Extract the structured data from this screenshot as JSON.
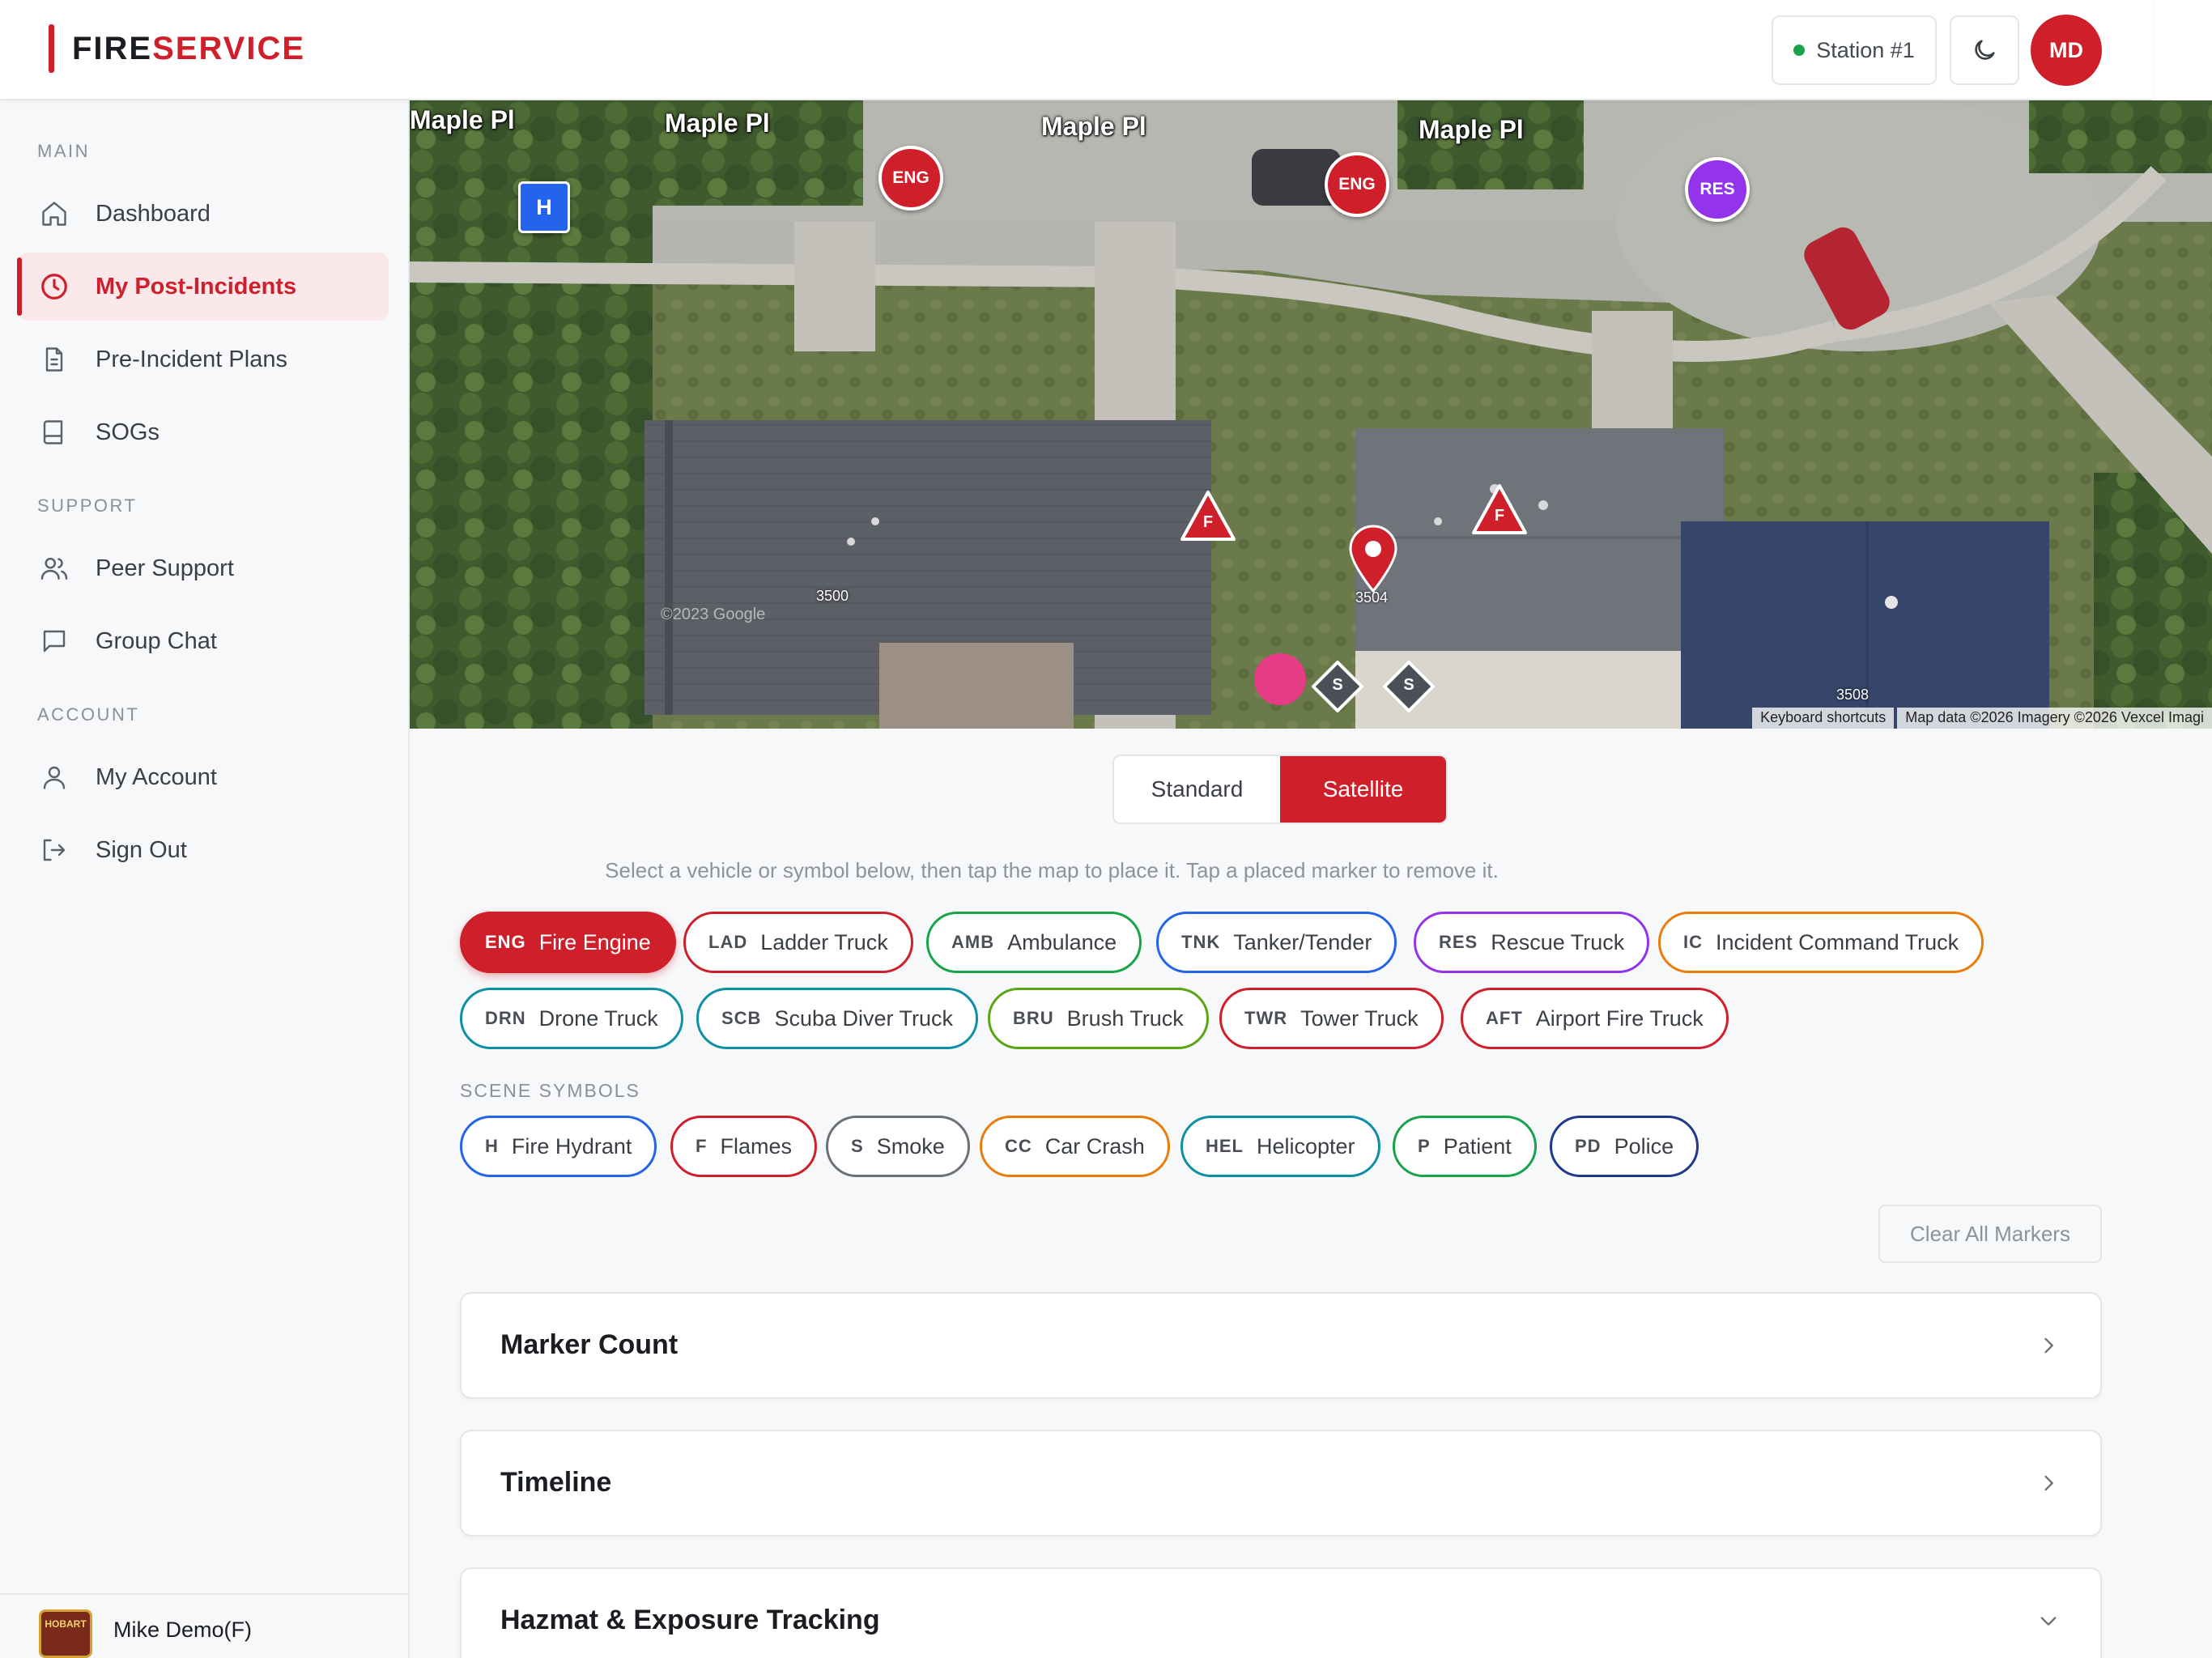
{
  "header": {
    "logo_fire": "FIRE",
    "logo_service": "SERVICE",
    "station": "Station #1",
    "theme_icon": "moon-icon",
    "avatar_initials": "MD"
  },
  "sidebar": {
    "section_main": "MAIN",
    "section_support": "SUPPORT",
    "section_account": "ACCOUNT",
    "items": [
      {
        "label": "Dashboard",
        "icon": "home-icon"
      },
      {
        "label": "My Post-Incidents",
        "icon": "clock-icon"
      },
      {
        "label": "Pre-Incident Plans",
        "icon": "document-icon"
      },
      {
        "label": "SOGs",
        "icon": "book-icon"
      },
      {
        "label": "Peer Support",
        "icon": "users-icon"
      },
      {
        "label": "Group Chat",
        "icon": "chat-icon"
      },
      {
        "label": "My Account",
        "icon": "user-icon"
      },
      {
        "label": "Sign Out",
        "icon": "sign-out-icon"
      }
    ],
    "user_name": "Mike Demo(F)",
    "user_badge": "HOBART"
  },
  "map": {
    "streets": [
      "Maple Pl",
      "Maple Pl",
      "Maple Pl",
      "Maple Pl"
    ],
    "house_numbers": [
      "3500",
      "3504",
      "3508"
    ],
    "markers": {
      "hydrant": "H",
      "eng1": "ENG",
      "eng2": "ENG",
      "res": "RES",
      "flame1": "F",
      "flame2": "F",
      "smoke1": "S",
      "smoke2": "S"
    },
    "attribution_shortcuts": "Keyboard shortcuts",
    "attribution_data": "Map data ©2026 Imagery ©2026 Vexcel Imagi",
    "watermark": "©2023 Google"
  },
  "map_type": {
    "standard": "Standard",
    "satellite": "Satellite",
    "selected": "Satellite"
  },
  "hint": "Select a vehicle or symbol below, then tap the map to place it. Tap a placed marker to remove it.",
  "vehicles": [
    {
      "code": "ENG",
      "label": "Fire Engine",
      "color": "#cf1f2a",
      "active": true
    },
    {
      "code": "LAD",
      "label": "Ladder Truck",
      "color": "#cf1f2a"
    },
    {
      "code": "AMB",
      "label": "Ambulance",
      "color": "#16a34a"
    },
    {
      "code": "TNK",
      "label": "Tanker/Tender",
      "color": "#2463eb"
    },
    {
      "code": "RES",
      "label": "Rescue Truck",
      "color": "#9333ea"
    },
    {
      "code": "IC",
      "label": "Incident Command Truck",
      "color": "#ea7c0c"
    },
    {
      "code": "DRN",
      "label": "Drone Truck",
      "color": "#0e8fa3"
    },
    {
      "code": "SCB",
      "label": "Scuba Diver Truck",
      "color": "#0e8fa3"
    },
    {
      "code": "BRU",
      "label": "Brush Truck",
      "color": "#5aa513"
    },
    {
      "code": "TWR",
      "label": "Tower Truck",
      "color": "#cf1f2a"
    },
    {
      "code": "AFT",
      "label": "Airport Fire Truck",
      "color": "#cf1f2a"
    }
  ],
  "scene_symbols_label": "SCENE SYMBOLS",
  "symbols": [
    {
      "code": "H",
      "label": "Fire Hydrant",
      "color": "#2463eb"
    },
    {
      "code": "F",
      "label": "Flames",
      "color": "#cf1f2a"
    },
    {
      "code": "S",
      "label": "Smoke",
      "color": "#6b7079"
    },
    {
      "code": "CC",
      "label": "Car Crash",
      "color": "#ea7c0c"
    },
    {
      "code": "HEL",
      "label": "Helicopter",
      "color": "#0e8fa3"
    },
    {
      "code": "P",
      "label": "Patient",
      "color": "#16a34a"
    },
    {
      "code": "PD",
      "label": "Police",
      "color": "#1e3a8a"
    }
  ],
  "clear_button": "Clear All Markers",
  "panels": [
    {
      "title": "Marker Count",
      "chevron": "chevron-right-icon"
    },
    {
      "title": "Timeline",
      "chevron": "chevron-right-icon"
    },
    {
      "title": "Hazmat & Exposure Tracking",
      "chevron": "chevron-down-icon"
    }
  ]
}
